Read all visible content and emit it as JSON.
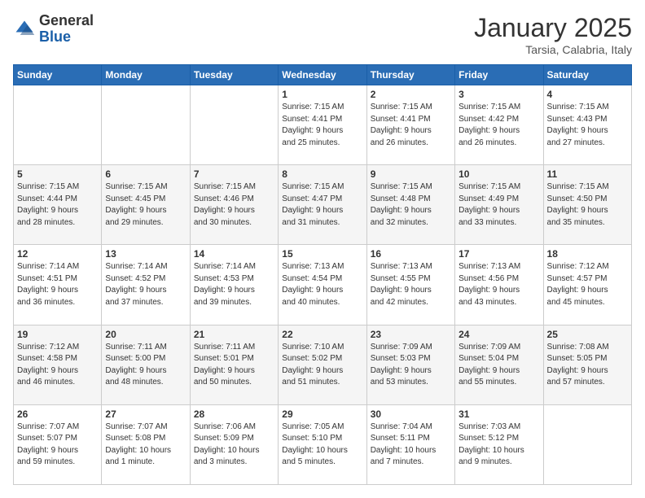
{
  "header": {
    "logo_general": "General",
    "logo_blue": "Blue",
    "month_title": "January 2025",
    "location": "Tarsia, Calabria, Italy"
  },
  "weekdays": [
    "Sunday",
    "Monday",
    "Tuesday",
    "Wednesday",
    "Thursday",
    "Friday",
    "Saturday"
  ],
  "weeks": [
    [
      {
        "day": "",
        "info": ""
      },
      {
        "day": "",
        "info": ""
      },
      {
        "day": "",
        "info": ""
      },
      {
        "day": "1",
        "info": "Sunrise: 7:15 AM\nSunset: 4:41 PM\nDaylight: 9 hours\nand 25 minutes."
      },
      {
        "day": "2",
        "info": "Sunrise: 7:15 AM\nSunset: 4:41 PM\nDaylight: 9 hours\nand 26 minutes."
      },
      {
        "day": "3",
        "info": "Sunrise: 7:15 AM\nSunset: 4:42 PM\nDaylight: 9 hours\nand 26 minutes."
      },
      {
        "day": "4",
        "info": "Sunrise: 7:15 AM\nSunset: 4:43 PM\nDaylight: 9 hours\nand 27 minutes."
      }
    ],
    [
      {
        "day": "5",
        "info": "Sunrise: 7:15 AM\nSunset: 4:44 PM\nDaylight: 9 hours\nand 28 minutes."
      },
      {
        "day": "6",
        "info": "Sunrise: 7:15 AM\nSunset: 4:45 PM\nDaylight: 9 hours\nand 29 minutes."
      },
      {
        "day": "7",
        "info": "Sunrise: 7:15 AM\nSunset: 4:46 PM\nDaylight: 9 hours\nand 30 minutes."
      },
      {
        "day": "8",
        "info": "Sunrise: 7:15 AM\nSunset: 4:47 PM\nDaylight: 9 hours\nand 31 minutes."
      },
      {
        "day": "9",
        "info": "Sunrise: 7:15 AM\nSunset: 4:48 PM\nDaylight: 9 hours\nand 32 minutes."
      },
      {
        "day": "10",
        "info": "Sunrise: 7:15 AM\nSunset: 4:49 PM\nDaylight: 9 hours\nand 33 minutes."
      },
      {
        "day": "11",
        "info": "Sunrise: 7:15 AM\nSunset: 4:50 PM\nDaylight: 9 hours\nand 35 minutes."
      }
    ],
    [
      {
        "day": "12",
        "info": "Sunrise: 7:14 AM\nSunset: 4:51 PM\nDaylight: 9 hours\nand 36 minutes."
      },
      {
        "day": "13",
        "info": "Sunrise: 7:14 AM\nSunset: 4:52 PM\nDaylight: 9 hours\nand 37 minutes."
      },
      {
        "day": "14",
        "info": "Sunrise: 7:14 AM\nSunset: 4:53 PM\nDaylight: 9 hours\nand 39 minutes."
      },
      {
        "day": "15",
        "info": "Sunrise: 7:13 AM\nSunset: 4:54 PM\nDaylight: 9 hours\nand 40 minutes."
      },
      {
        "day": "16",
        "info": "Sunrise: 7:13 AM\nSunset: 4:55 PM\nDaylight: 9 hours\nand 42 minutes."
      },
      {
        "day": "17",
        "info": "Sunrise: 7:13 AM\nSunset: 4:56 PM\nDaylight: 9 hours\nand 43 minutes."
      },
      {
        "day": "18",
        "info": "Sunrise: 7:12 AM\nSunset: 4:57 PM\nDaylight: 9 hours\nand 45 minutes."
      }
    ],
    [
      {
        "day": "19",
        "info": "Sunrise: 7:12 AM\nSunset: 4:58 PM\nDaylight: 9 hours\nand 46 minutes."
      },
      {
        "day": "20",
        "info": "Sunrise: 7:11 AM\nSunset: 5:00 PM\nDaylight: 9 hours\nand 48 minutes."
      },
      {
        "day": "21",
        "info": "Sunrise: 7:11 AM\nSunset: 5:01 PM\nDaylight: 9 hours\nand 50 minutes."
      },
      {
        "day": "22",
        "info": "Sunrise: 7:10 AM\nSunset: 5:02 PM\nDaylight: 9 hours\nand 51 minutes."
      },
      {
        "day": "23",
        "info": "Sunrise: 7:09 AM\nSunset: 5:03 PM\nDaylight: 9 hours\nand 53 minutes."
      },
      {
        "day": "24",
        "info": "Sunrise: 7:09 AM\nSunset: 5:04 PM\nDaylight: 9 hours\nand 55 minutes."
      },
      {
        "day": "25",
        "info": "Sunrise: 7:08 AM\nSunset: 5:05 PM\nDaylight: 9 hours\nand 57 minutes."
      }
    ],
    [
      {
        "day": "26",
        "info": "Sunrise: 7:07 AM\nSunset: 5:07 PM\nDaylight: 9 hours\nand 59 minutes."
      },
      {
        "day": "27",
        "info": "Sunrise: 7:07 AM\nSunset: 5:08 PM\nDaylight: 10 hours\nand 1 minute."
      },
      {
        "day": "28",
        "info": "Sunrise: 7:06 AM\nSunset: 5:09 PM\nDaylight: 10 hours\nand 3 minutes."
      },
      {
        "day": "29",
        "info": "Sunrise: 7:05 AM\nSunset: 5:10 PM\nDaylight: 10 hours\nand 5 minutes."
      },
      {
        "day": "30",
        "info": "Sunrise: 7:04 AM\nSunset: 5:11 PM\nDaylight: 10 hours\nand 7 minutes."
      },
      {
        "day": "31",
        "info": "Sunrise: 7:03 AM\nSunset: 5:12 PM\nDaylight: 10 hours\nand 9 minutes."
      },
      {
        "day": "",
        "info": ""
      }
    ]
  ]
}
